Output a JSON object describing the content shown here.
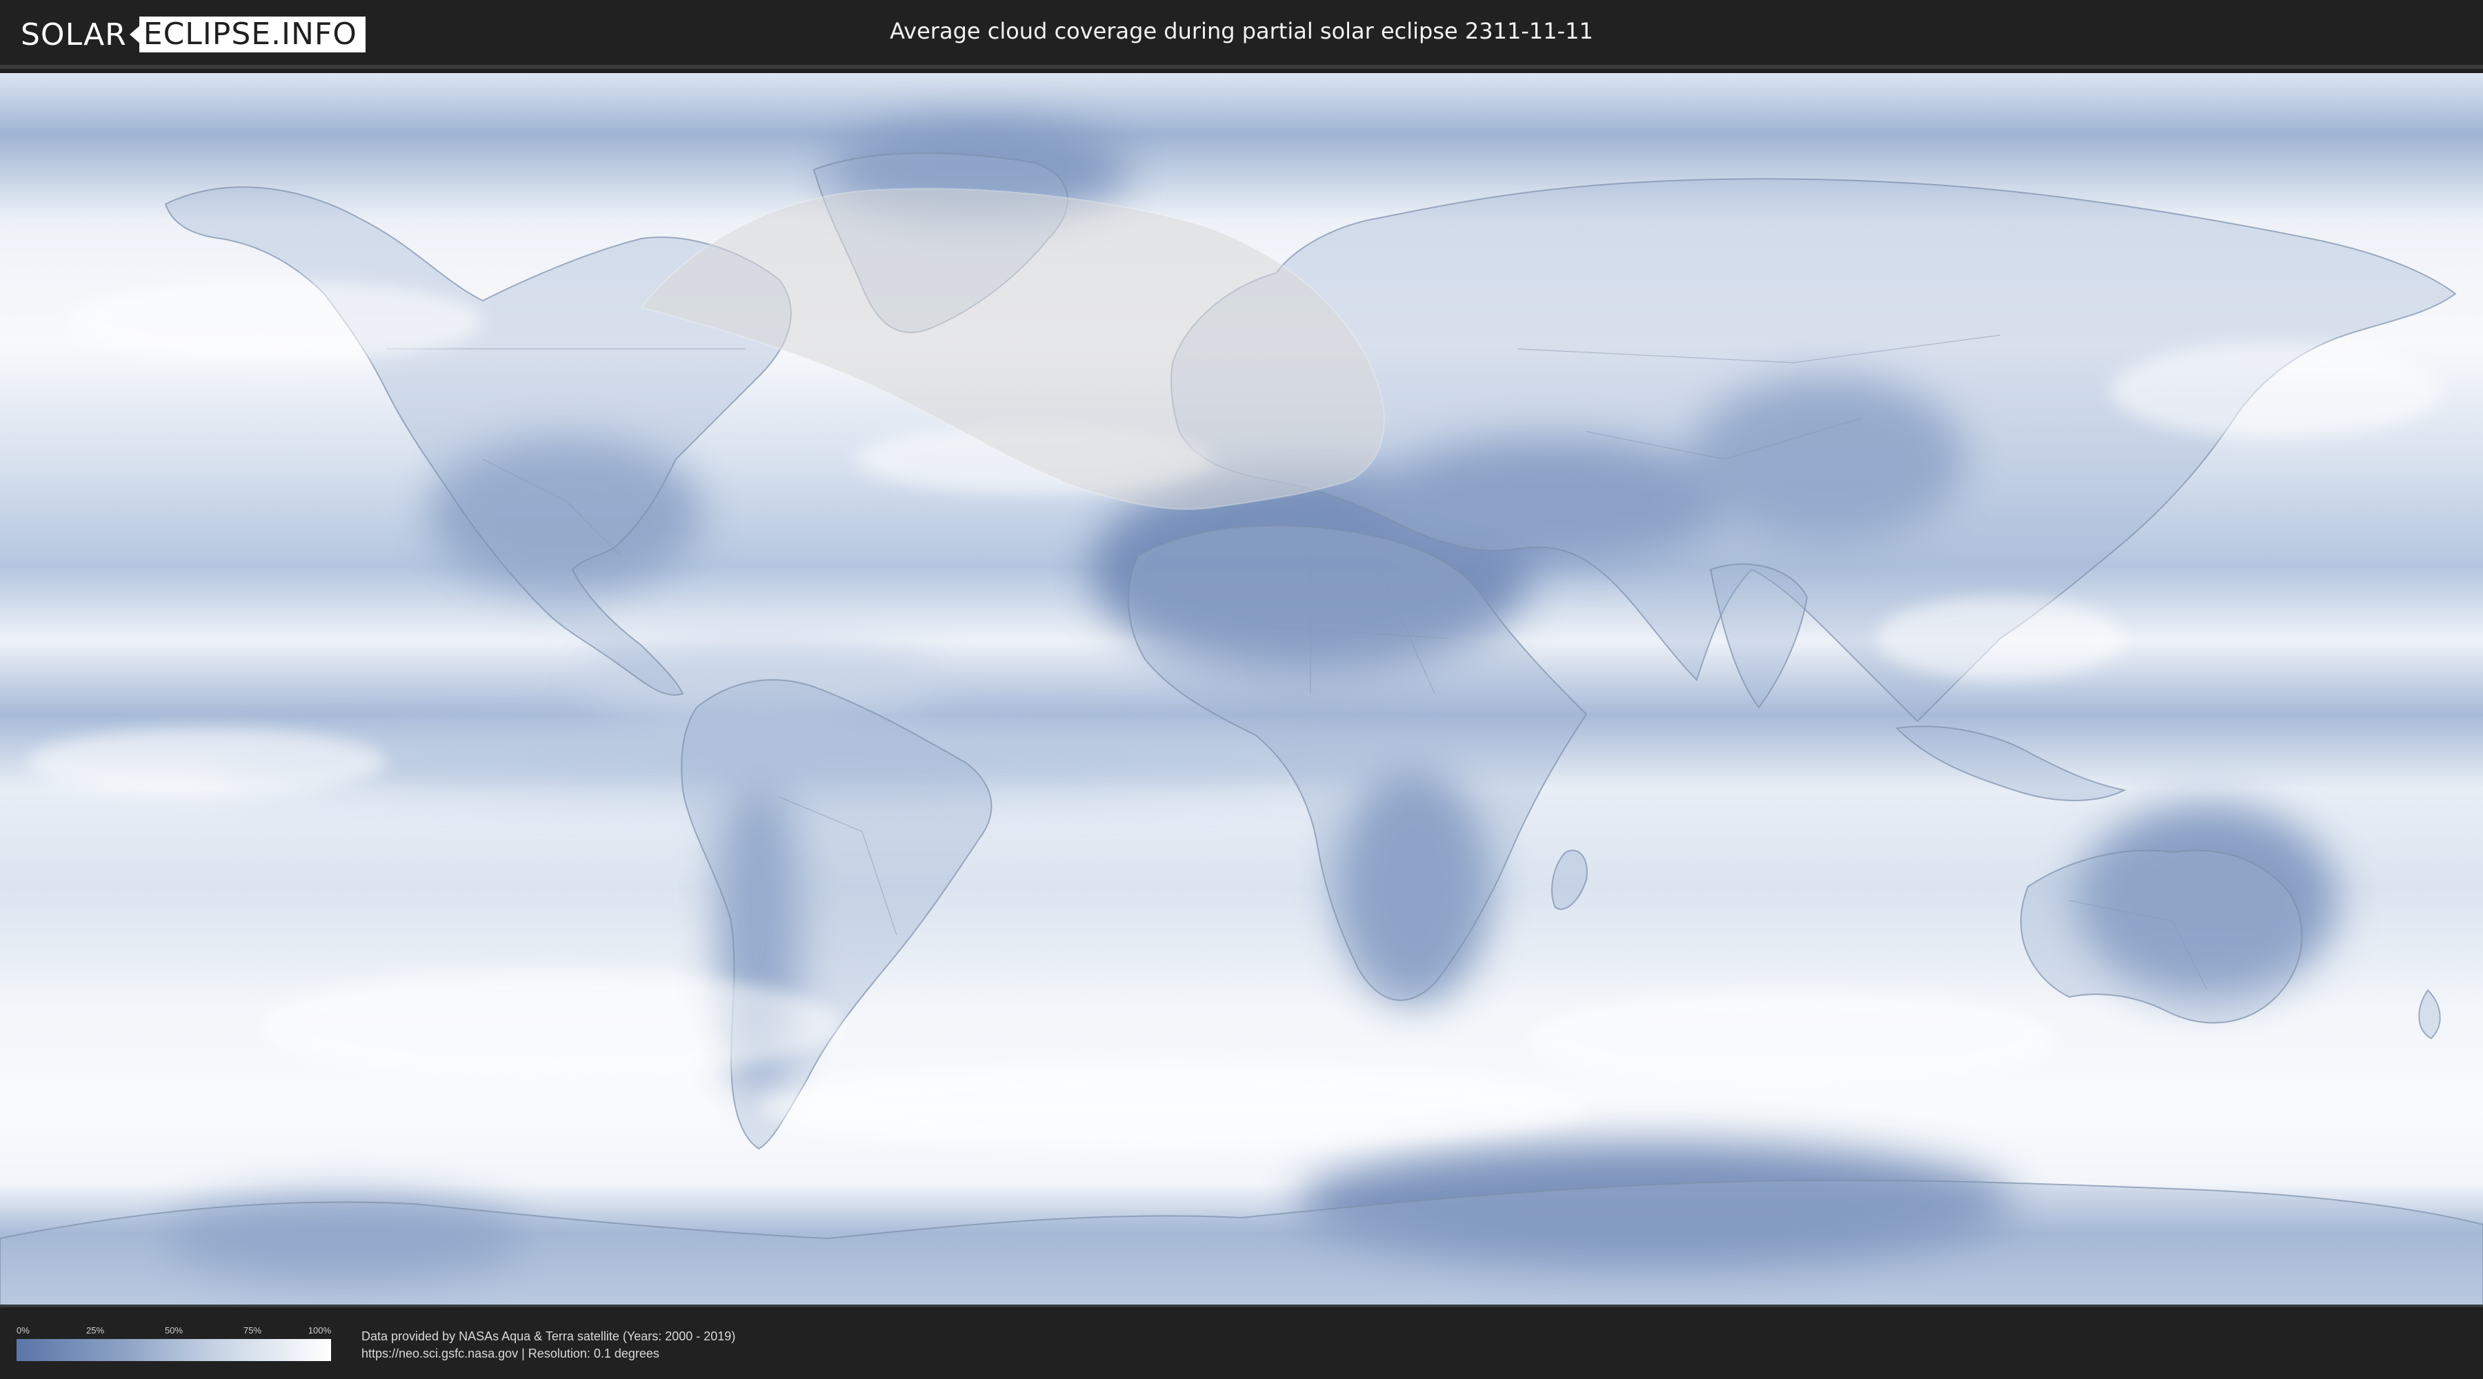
{
  "header": {
    "logo_solar": "SOLAR",
    "logo_eclipse": "ECLIPSE.INFO",
    "title": "Average cloud coverage during partial solar eclipse 2311-11-11"
  },
  "map": {
    "colors": {
      "clear": "#5a76a8",
      "mid": "#a9bcd8",
      "cloudy": "#f7f9fc",
      "eclipse_zone": "#d9d9d9",
      "borders": "#8898b0"
    }
  },
  "legend": {
    "ticks": [
      "0%",
      "25%",
      "50%",
      "75%",
      "100%"
    ],
    "tick_fractions": [
      0,
      0.25,
      0.5,
      0.75,
      1.0
    ]
  },
  "credits": {
    "line1": "Data provided by NASAs Aqua & Terra satellite (Years: 2000 - 2019)",
    "line2": "https://neo.sci.gsfc.nasa.gov | Resolution: 0.1 degrees"
  }
}
